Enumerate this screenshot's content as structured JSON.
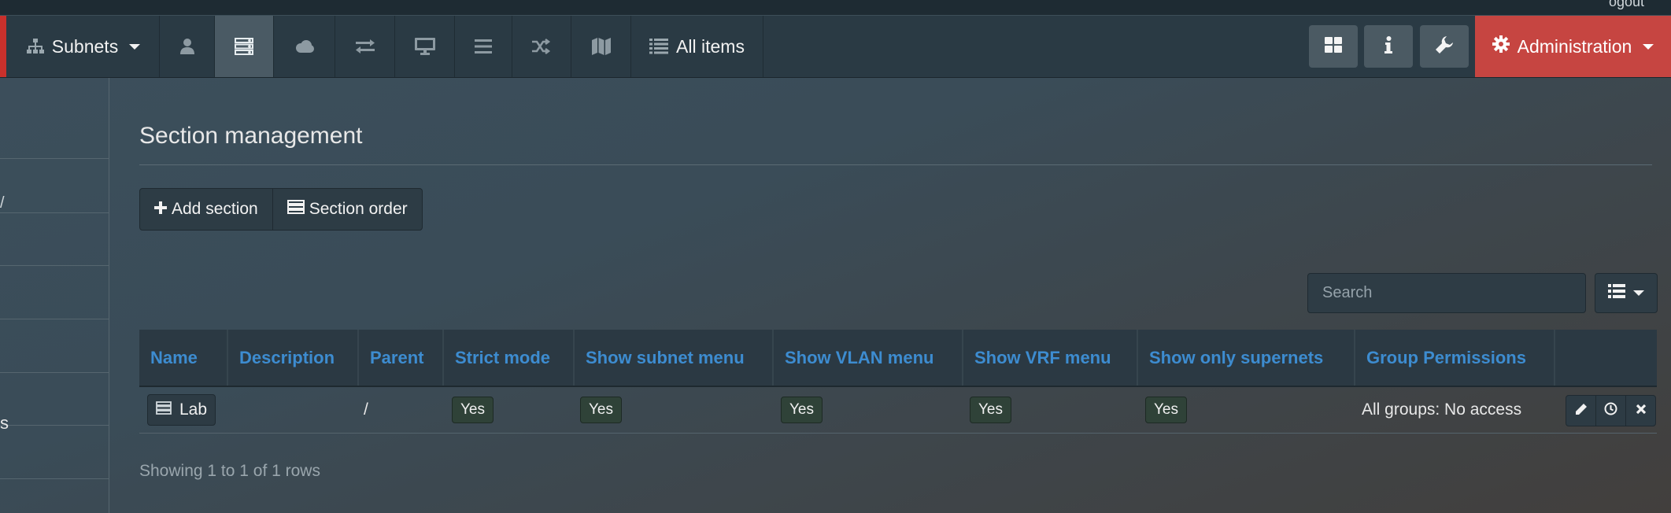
{
  "top_strip": {
    "partial_text": "ogout"
  },
  "nav": {
    "subnets_label": "Subnets",
    "all_items_label": "All items",
    "administration_label": "Administration"
  },
  "sidebar": {
    "partial_item": "s",
    "partial_mark": "/"
  },
  "main": {
    "title": "Section management",
    "add_section_label": "Add section",
    "section_order_label": "Section order",
    "search_placeholder": "Search"
  },
  "table": {
    "headers": [
      "Name",
      "Description",
      "Parent",
      "Strict mode",
      "Show subnet menu",
      "Show VLAN menu",
      "Show VRF menu",
      "Show only supernets",
      "Group Permissions"
    ],
    "rows": [
      {
        "name": "Lab",
        "description": "",
        "parent": "/",
        "strict_mode": "Yes",
        "show_subnet_menu": "Yes",
        "show_vlan_menu": "Yes",
        "show_vrf_menu": "Yes",
        "show_only_supernets": "Yes",
        "group_permissions": "All groups: No access"
      }
    ],
    "footer": "Showing 1 to 1 of 1 rows"
  },
  "colors": {
    "accent_red": "#c64541",
    "header_link_blue": "#3d8cd0",
    "badge_green": "#2f4238"
  },
  "icons": [
    "sitemap-icon",
    "user-icon",
    "server-icon",
    "cloud-icon",
    "exchange-icon",
    "monitor-icon",
    "bars-icon",
    "random-icon",
    "map-icon",
    "list-icon",
    "dashboard-icon",
    "info-icon",
    "wrench-icon",
    "gear-icon",
    "plus-icon",
    "pencil-icon",
    "clock-icon",
    "close-icon"
  ]
}
